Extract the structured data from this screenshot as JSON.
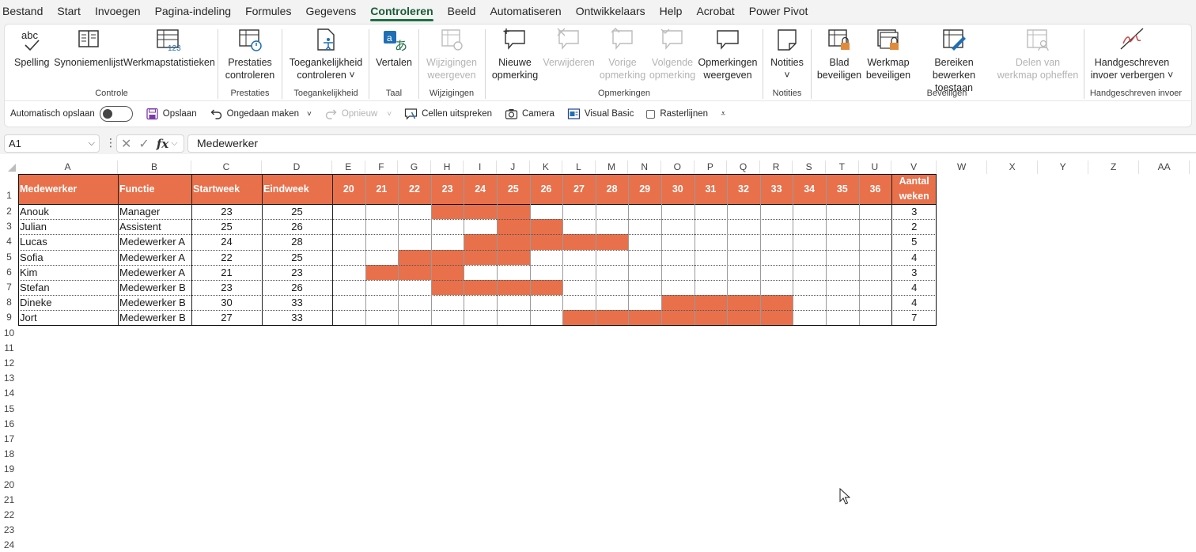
{
  "menu": {
    "tabs": [
      {
        "label": "Bestand",
        "active": false
      },
      {
        "label": "Start",
        "active": false
      },
      {
        "label": "Invoegen",
        "active": false
      },
      {
        "label": "Pagina-indeling",
        "active": false
      },
      {
        "label": "Formules",
        "active": false
      },
      {
        "label": "Gegevens",
        "active": false
      },
      {
        "label": "Controleren",
        "active": true
      },
      {
        "label": "Beeld",
        "active": false
      },
      {
        "label": "Automatiseren",
        "active": false
      },
      {
        "label": "Ontwikkelaars",
        "active": false
      },
      {
        "label": "Help",
        "active": false
      },
      {
        "label": "Acrobat",
        "active": false
      },
      {
        "label": "Power Pivot",
        "active": false
      }
    ]
  },
  "ribbon": {
    "spelling": {
      "line1": "abc",
      "label": "Spelling"
    },
    "synoniemen": "Synoniemenlijst",
    "werkmapstat": "Werkmapstatistieken",
    "controle": "Controle",
    "prestaties_l1": "Prestaties",
    "prestaties_l2": "controleren",
    "prestaties_group": "Prestaties",
    "toegank_l1": "Toegankelijkheid",
    "toegank_l2": "controleren",
    "toegank_group": "Toegankelijkheid",
    "vertalen": "Vertalen",
    "taal_group": "Taal",
    "wijz_l1": "Wijzigingen",
    "wijz_l2": "weergeven",
    "wijz_group": "Wijzigingen",
    "nieuwe_l1": "Nieuwe",
    "nieuwe_l2": "opmerking",
    "verwijderen": "Verwijderen",
    "vorige_l1": "Vorige",
    "vorige_l2": "opmerking",
    "volgende_l1": "Volgende",
    "volgende_l2": "opmerking",
    "opmweerg_l1": "Opmerkingen",
    "opmweerg_l2": "weergeven",
    "opm_group": "Opmerkingen",
    "notities": "Notities",
    "notities_group": "Notities",
    "blad_l1": "Blad",
    "blad_l2": "beveiligen",
    "werkmap_l1": "Werkmap",
    "werkmap_l2": "beveiligen",
    "bereiken_l1": "Bereiken",
    "bereiken_l2": "bewerken toestaan",
    "delen_l1": "Delen van",
    "delen_l2": "werkmap opheffen",
    "beveiligen_group": "Beveiligen",
    "hand_l1": "Handgeschreven",
    "hand_l2": "invoer verbergen",
    "hand_group": "Handgeschreven invoer"
  },
  "qat": {
    "autosave": "Automatisch opslaan",
    "save": "Opslaan",
    "undo": "Ongedaan maken",
    "redo": "Opnieuw",
    "speak": "Cellen uitspreken",
    "camera": "Camera",
    "vb": "Visual Basic",
    "gridlines": "Rasterlijnen"
  },
  "formula_bar": {
    "name_box": "A1",
    "fx": "fx",
    "content": "Medewerker"
  },
  "accent_color": "#e8704b",
  "sheet": {
    "columns": [
      "A",
      "B",
      "C",
      "D",
      "E",
      "F",
      "G",
      "H",
      "I",
      "J",
      "K",
      "L",
      "M",
      "N",
      "O",
      "P",
      "Q",
      "R",
      "S",
      "T",
      "U",
      "V",
      "W",
      "X",
      "Y",
      "Z",
      "AA"
    ],
    "rows": [
      "1",
      "2",
      "3",
      "4",
      "5",
      "6",
      "7",
      "8",
      "9",
      "10",
      "11",
      "12",
      "13",
      "14",
      "15",
      "16",
      "17",
      "18",
      "19",
      "20",
      "21",
      "22",
      "23",
      "24"
    ],
    "header": {
      "medewerker": "Medewerker",
      "functie": "Functie",
      "startweek": "Startweek",
      "eindweek": "Eindweek",
      "weeks": [
        "20",
        "21",
        "22",
        "23",
        "24",
        "25",
        "26",
        "27",
        "28",
        "29",
        "30",
        "31",
        "32",
        "33",
        "34",
        "35",
        "36"
      ],
      "aantal_l1": "Aantal",
      "aantal_l2": "weken"
    },
    "records": [
      {
        "name": "Anouk",
        "role": "Manager",
        "start": "23",
        "end": "25",
        "count": "3"
      },
      {
        "name": "Julian",
        "role": "Assistent",
        "start": "25",
        "end": "26",
        "count": "2"
      },
      {
        "name": "Lucas",
        "role": "Medewerker A",
        "start": "24",
        "end": "28",
        "count": "5"
      },
      {
        "name": "Sofia",
        "role": "Medewerker A",
        "start": "22",
        "end": "25",
        "count": "4"
      },
      {
        "name": "Kim",
        "role": "Medewerker A",
        "start": "21",
        "end": "23",
        "count": "3"
      },
      {
        "name": "Stefan",
        "role": "Medewerker B",
        "start": "23",
        "end": "26",
        "count": "4"
      },
      {
        "name": "Dineke",
        "role": "Medewerker B",
        "start": "30",
        "end": "33",
        "count": "4"
      },
      {
        "name": "Jort",
        "role": "Medewerker B",
        "start": "27",
        "end": "33",
        "count": "7"
      }
    ]
  }
}
